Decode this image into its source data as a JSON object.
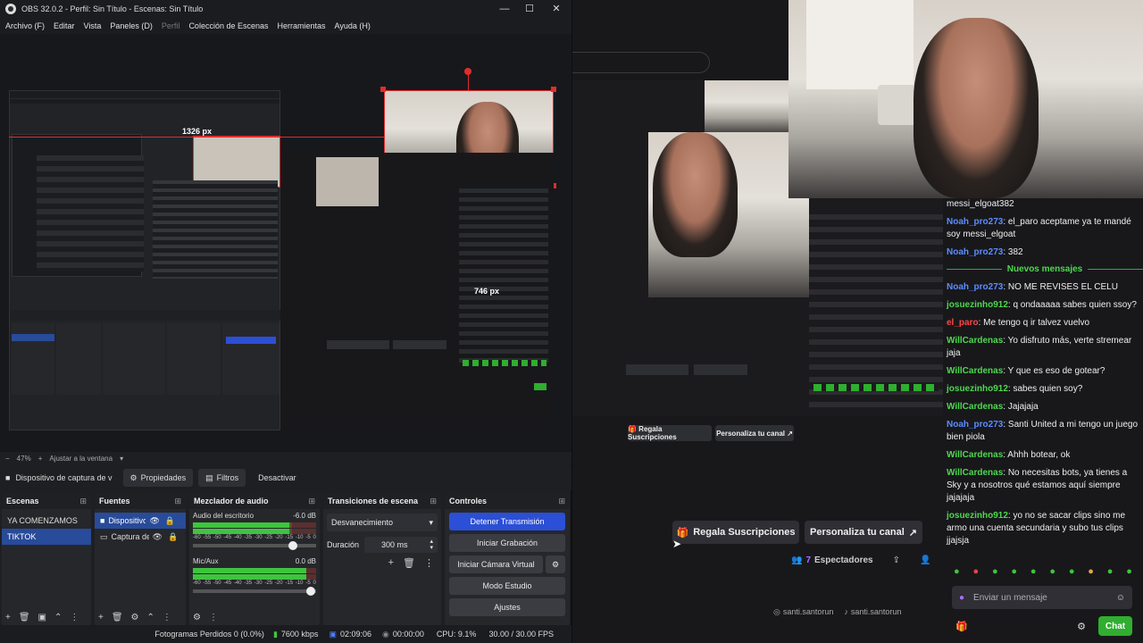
{
  "window": {
    "title": "OBS 32.0.2 - Perfil: Sin Título - Escenas: Sin Título",
    "minimize": "—",
    "maximize": "☐",
    "close": "✕"
  },
  "menu": [
    "Archivo (F)",
    "Editar",
    "Vista",
    "Paneles (D)",
    "Perfil",
    "Colección de Escenas",
    "Herramientas",
    "Ayuda (H)"
  ],
  "preview": {
    "label_width": "1326 px",
    "label_height": "746 px",
    "inner_width_label": "1326 px"
  },
  "zoom": {
    "minus": "−",
    "value": "47%",
    "plus": "+",
    "fit": "Ajustar a la ventana"
  },
  "source_toolbar": {
    "source_name": "Dispositivo de captura de v",
    "properties": "Propiedades",
    "filters": "Filtros",
    "deactivate": "Desactivar"
  },
  "scenes": {
    "header": "Escenas",
    "items": [
      "YA COMENZAMOS",
      "TIKTOK"
    ],
    "selected": 1
  },
  "sources": {
    "header": "Fuentes",
    "items": [
      "Dispositivo",
      "Captura de"
    ]
  },
  "mixer": {
    "header": "Mezclador de audio",
    "channels": [
      {
        "name": "Audio del escritorio",
        "db": "-6.0 dB",
        "level": 0.78,
        "fader": 0.85
      },
      {
        "name": "Mic/Aux",
        "db": "0.0 dB",
        "level": 0.92,
        "fader": 0.99
      }
    ],
    "scale": [
      "-60",
      "-55",
      "-50",
      "-45",
      "-40",
      "-35",
      "-30",
      "-25",
      "-20",
      "-15",
      "-10",
      "-5",
      "0"
    ]
  },
  "transitions": {
    "header": "Transiciones de escena",
    "selected": "Desvanecimiento",
    "duration_label": "Duración",
    "duration_value": "300 ms"
  },
  "controls": {
    "header": "Controles",
    "stop_stream": "Detener Transmisión",
    "start_recording": "Iniciar Grabación",
    "virtual_cam": "Iniciar Cámara Virtual",
    "studio": "Modo Estudio",
    "settings": "Ajustes"
  },
  "status": {
    "dropped": "Fotogramas Perdidos 0 (0.0%)",
    "bitrate": "7600 kbps",
    "time_live": "02:09:06",
    "time_rec": "00:00:00",
    "cpu": "CPU: 9.1%",
    "fps": "30.00 / 30.00 FPS"
  },
  "stream": {
    "gift_button": "Regala Suscripciones",
    "customize_button": "Personaliza tu canal",
    "viewers": "7",
    "viewers_label": "Espectadores",
    "social1": "santi.santorun",
    "social2": "santi.santorun"
  },
  "chat": {
    "messages": [
      {
        "user": "",
        "text": "messi_elgoat382"
      },
      {
        "user": "Noah_pro273",
        "text": ": el_paro aceptame ya te mandé soy messi_elgoat"
      },
      {
        "user": "Noah_pro273",
        "text": ": 382"
      },
      {
        "user": "",
        "text": "Nuevos mensajes"
      },
      {
        "user": "Noah_pro273",
        "text": ": NO ME REVISES EL CELU"
      },
      {
        "user": "josuezinho912",
        "text": ": q ondaaaaa sabes quien ssoy?"
      },
      {
        "user": "el_paro",
        "text": ": Me tengo q ir talvez vuelvo"
      },
      {
        "user": "WillCardenas",
        "text": ": Yo disfruto más, verte stremear jaja"
      },
      {
        "user": "WillCardenas",
        "text": ": Y que es eso de gotear?"
      },
      {
        "user": "josuezinho912",
        "text": ": sabes quien soy?"
      },
      {
        "user": "WillCardenas",
        "text": ": Jajajaja"
      },
      {
        "user": "Noah_pro273",
        "text": ": Santi United a mi tengo un juego bien piola"
      },
      {
        "user": "WillCardenas",
        "text": ": Ahhh botear, ok"
      },
      {
        "user": "WillCardenas",
        "text": ": No necesitas bots, ya tienes a Sky y a nosotros qué estamos aquí siempre jajajaja"
      },
      {
        "user": "josuezinho912",
        "text": ": yo no se sacar clips sino me armo una cuenta secundaria y subo tus clips jjajsja"
      }
    ],
    "input_placeholder": "Enviar un mensaje",
    "send": "Chat"
  }
}
